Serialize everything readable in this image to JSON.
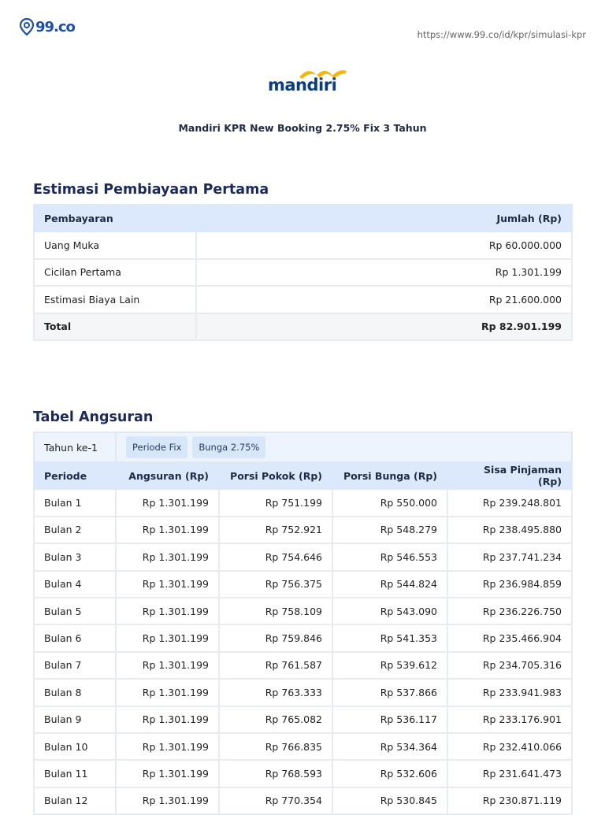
{
  "header": {
    "brand": "99.co",
    "url": "https://www.99.co/id/kpr/simulasi-kpr"
  },
  "bank": {
    "logo": "mandiri",
    "product": "Mandiri KPR New Booking 2.75% Fix 3 Tahun"
  },
  "estimasi": {
    "title": "Estimasi Pembiayaan Pertama",
    "col_label": "Pembayaran",
    "col_value": "Jumlah (Rp)",
    "rows": [
      {
        "label": "Uang Muka",
        "value": "Rp 60.000.000"
      },
      {
        "label": "Cicilan Pertama",
        "value": "Rp 1.301.199"
      },
      {
        "label": "Estimasi Biaya Lain",
        "value": "Rp 21.600.000"
      }
    ],
    "total_label": "Total",
    "total_value": "Rp 82.901.199"
  },
  "angsuran": {
    "title": "Tabel Angsuran",
    "year_label": "Tahun ke-1",
    "chips": [
      "Periode Fix",
      "Bunga 2.75%"
    ],
    "columns": [
      "Periode",
      "Angsuran (Rp)",
      "Porsi Pokok (Rp)",
      "Porsi Bunga (Rp)",
      "Sisa Pinjaman (Rp)"
    ],
    "rows": [
      [
        "Bulan 1",
        "Rp 1.301.199",
        "Rp 751.199",
        "Rp 550.000",
        "Rp 239.248.801"
      ],
      [
        "Bulan 2",
        "Rp 1.301.199",
        "Rp 752.921",
        "Rp 548.279",
        "Rp 238.495.880"
      ],
      [
        "Bulan 3",
        "Rp 1.301.199",
        "Rp 754.646",
        "Rp 546.553",
        "Rp 237.741.234"
      ],
      [
        "Bulan 4",
        "Rp 1.301.199",
        "Rp 756.375",
        "Rp 544.824",
        "Rp 236.984.859"
      ],
      [
        "Bulan 5",
        "Rp 1.301.199",
        "Rp 758.109",
        "Rp 543.090",
        "Rp 236.226.750"
      ],
      [
        "Bulan 6",
        "Rp 1.301.199",
        "Rp 759.846",
        "Rp 541.353",
        "Rp 235.466.904"
      ],
      [
        "Bulan 7",
        "Rp 1.301.199",
        "Rp 761.587",
        "Rp 539.612",
        "Rp 234.705.316"
      ],
      [
        "Bulan 8",
        "Rp 1.301.199",
        "Rp 763.333",
        "Rp 537.866",
        "Rp 233.941.983"
      ],
      [
        "Bulan 9",
        "Rp 1.301.199",
        "Rp 765.082",
        "Rp 536.117",
        "Rp 233.176.901"
      ],
      [
        "Bulan 10",
        "Rp 1.301.199",
        "Rp 766.835",
        "Rp 534.364",
        "Rp 232.410.066"
      ],
      [
        "Bulan 11",
        "Rp 1.301.199",
        "Rp 768.593",
        "Rp 532.606",
        "Rp 231.641.473"
      ],
      [
        "Bulan 12",
        "Rp 1.301.199",
        "Rp 770.354",
        "Rp 530.845",
        "Rp 230.871.119"
      ]
    ]
  }
}
